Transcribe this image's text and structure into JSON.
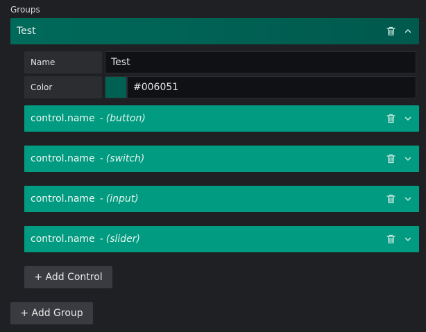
{
  "section": {
    "label": "Groups"
  },
  "group": {
    "title": "Test",
    "fields": {
      "name_label": "Name",
      "name_value": "Test",
      "color_label": "Color",
      "color_value": "#006051"
    },
    "controls": [
      {
        "name": "control.name",
        "sep": "-",
        "type": "(button)"
      },
      {
        "name": "control.name",
        "sep": "-",
        "type": "(switch)"
      },
      {
        "name": "control.name",
        "sep": "-",
        "type": "(input)"
      },
      {
        "name": "control.name",
        "sep": "-",
        "type": "(slider)"
      }
    ],
    "add_control_label": "+ Add Control"
  },
  "add_group_label": "+ Add Group",
  "colors": {
    "group_header": "#006051",
    "control_row": "#009b80",
    "swatch": "#006051"
  },
  "icons": {
    "delete": "trash-icon",
    "collapse": "chevron-up-icon",
    "expand": "chevron-down-icon"
  }
}
